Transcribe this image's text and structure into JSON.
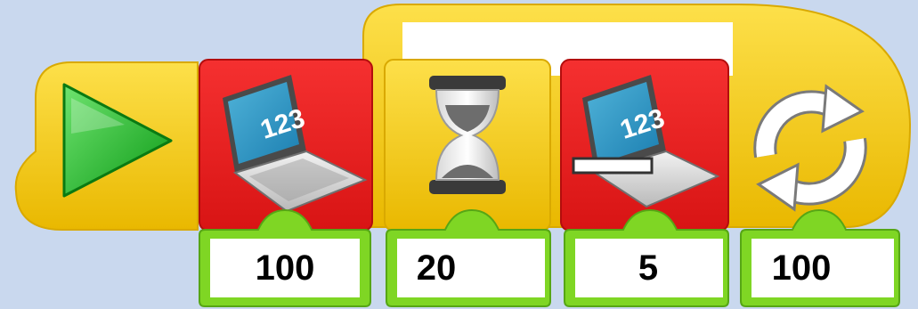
{
  "program": {
    "blocks": [
      {
        "type": "start",
        "icon": "play-icon"
      },
      {
        "type": "display",
        "icon": "laptop-display-icon",
        "screen_text": "123",
        "color": "#e31e1e"
      },
      {
        "type": "wait",
        "icon": "hourglass-icon",
        "color": "#f5c400"
      },
      {
        "type": "subtract-from-display",
        "icon": "laptop-subtract-icon",
        "screen_text": "123",
        "color": "#e31e1e"
      },
      {
        "type": "loop",
        "icon": "loop-arrows-icon",
        "color": "#f5c400"
      }
    ],
    "inputs": [
      {
        "value": "100"
      },
      {
        "value": "20"
      },
      {
        "value": "5"
      },
      {
        "value": "100"
      }
    ]
  },
  "colors": {
    "background": "#c9d8ee",
    "yellow": "#f5c400",
    "red": "#e31e1e",
    "green": "#7ed321"
  }
}
